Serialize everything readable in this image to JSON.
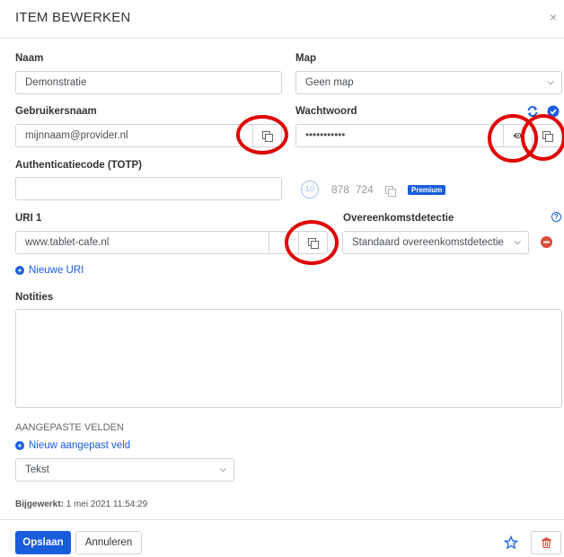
{
  "dialog": {
    "title": "ITEM BEWERKEN",
    "close_glyph": "×"
  },
  "fields": {
    "name": {
      "label": "Naam",
      "value": "Demonstratie"
    },
    "folder": {
      "label": "Map",
      "value": "Geen map"
    },
    "username": {
      "label": "Gebruikersnaam",
      "value": "mijnnaam@provider.nl"
    },
    "password": {
      "label": "Wachtwoord",
      "value": "•••••••••••"
    },
    "totp": {
      "label": "Authenticatiecode (TOTP)",
      "value": "",
      "countdown": "10",
      "code": "878  724",
      "premium_badge": "Premium"
    },
    "uri": {
      "label": "URI 1",
      "value": "www.tablet-cafe.nl",
      "match_label": "Overeenkomstdetectie",
      "match_value": "Standaard overeenkomstdetectie",
      "help_glyph": "?"
    },
    "new_uri": "Nieuwe URI",
    "notes": {
      "label": "Notities",
      "value": ""
    }
  },
  "custom_fields": {
    "heading": "AANGEPASTE VELDEN",
    "add_label": "Nieuw aangepast veld",
    "type_value": "Tekst"
  },
  "updated": {
    "label": "Bijgewerkt:",
    "value": "1 mei 2021 11:54:29"
  },
  "footer": {
    "save_label": "Opslaan",
    "cancel_label": "Annuleren"
  },
  "colors": {
    "primary": "#175ddc",
    "danger": "#dd4b39",
    "annotation": "#e00000"
  },
  "icons": {
    "copy": "copy-icon",
    "eye": "eye-icon",
    "refresh": "refresh-icon",
    "check": "check-circle-icon",
    "star": "star-icon",
    "trash": "trash-icon",
    "minus": "minus-circle-icon",
    "plus": "plus-circle-icon",
    "chevron": "chevron-down-icon"
  }
}
